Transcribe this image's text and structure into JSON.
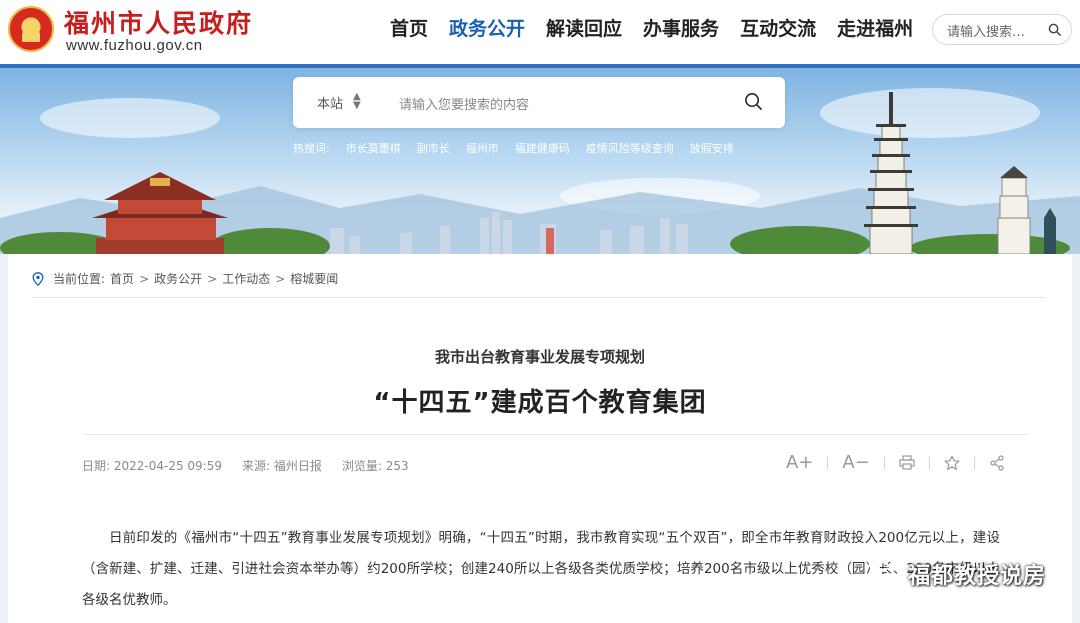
{
  "header": {
    "site_name": "福州市人民政府",
    "site_url": "www.fuzhou.gov.cn",
    "nav": [
      {
        "label": "首页",
        "active": false
      },
      {
        "label": "政务公开",
        "active": true
      },
      {
        "label": "解读回应",
        "active": false
      },
      {
        "label": "办事服务",
        "active": false
      },
      {
        "label": "互动交流",
        "active": false
      },
      {
        "label": "走进福州",
        "active": false
      }
    ],
    "search_placeholder": "请输入搜索…"
  },
  "banner": {
    "scope_label": "本站",
    "search_placeholder": "请输入您要搜索的内容",
    "hotwords_label": "热搜词:",
    "hotwords": [
      "市长莫蕾棋",
      "副市长",
      "福州市",
      "福建健康码",
      "疫情风险等级查询",
      "放假安排"
    ]
  },
  "breadcrumb": {
    "label": "当前位置:",
    "items": [
      "首页",
      "政务公开",
      "工作动态",
      "榕城要闻"
    ],
    "separator": ">"
  },
  "article": {
    "subtitle": "我市出台教育事业发展专项规划",
    "title": "“十四五”建成百个教育集团",
    "date": "日期: 2022-04-25 09:59",
    "source": "来源: 福州日报",
    "views": "浏览量: 253",
    "tools": {
      "font_larger": "A+",
      "font_smaller": "A−"
    },
    "body": "日前印发的《福州市“十四五”教育事业发展专项规划》明确，“十四五”时期，我市教育实现“五个双百”，即全市年教育财政投入200亿元以上，建设（含新建、扩建、迁建、引进社会资本举办等）约200所学校；创建240所以上各级各类优质学校；培养200名市级以上优秀校（园）长、200名市级以上各级名优教师。"
  },
  "watermark": {
    "text": "福都教授说房"
  },
  "colors": {
    "accent_blue": "#1b5fb3",
    "brand_red": "#c61d1d",
    "header_bar": "#2f6fbd"
  }
}
